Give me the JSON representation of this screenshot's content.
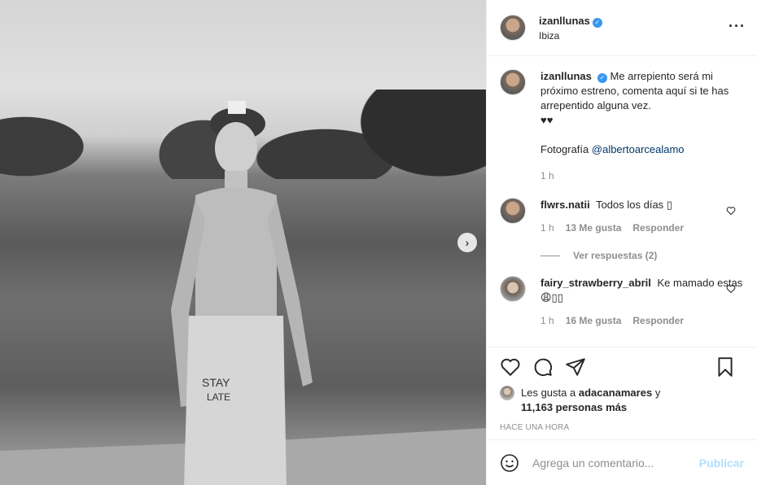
{
  "post": {
    "author": "izanllunas",
    "location": "Ibiza",
    "more_icon": "more-options-icon"
  },
  "caption": {
    "username": "izanllunas",
    "text": "Me arrepiento será mi próximo estreno, comenta aquí si te has arrepentido alguna vez.",
    "hearts": "♥♥",
    "photo_credit_label": "Fotografía",
    "photo_credit_handle": "@albertoarcealamo",
    "time": "1 h"
  },
  "comments": [
    {
      "username": "flwrs.natii",
      "text": "Todos los días ▯",
      "time": "1 h",
      "likes": "13 Me gusta",
      "reply": "Responder",
      "view_replies": "Ver respuestas (2)"
    },
    {
      "username": "fairy_strawberry_abril",
      "text": "Ke mamado estas😩▯▯",
      "time": "1 h",
      "likes": "16 Me gusta",
      "reply": "Responder"
    }
  ],
  "likes": {
    "prefix": "Les gusta a",
    "user": "adacanamares",
    "suffix": "y",
    "others": "11,163 personas más"
  },
  "timestamp": "HACE UNA HORA",
  "add_comment": {
    "placeholder": "Agrega un comentario...",
    "publish": "Publicar"
  },
  "colors": {
    "verified": "#3897f0",
    "link": "#00376b",
    "publish_disabled": "#b2dffc",
    "muted": "#8e8e8e"
  }
}
